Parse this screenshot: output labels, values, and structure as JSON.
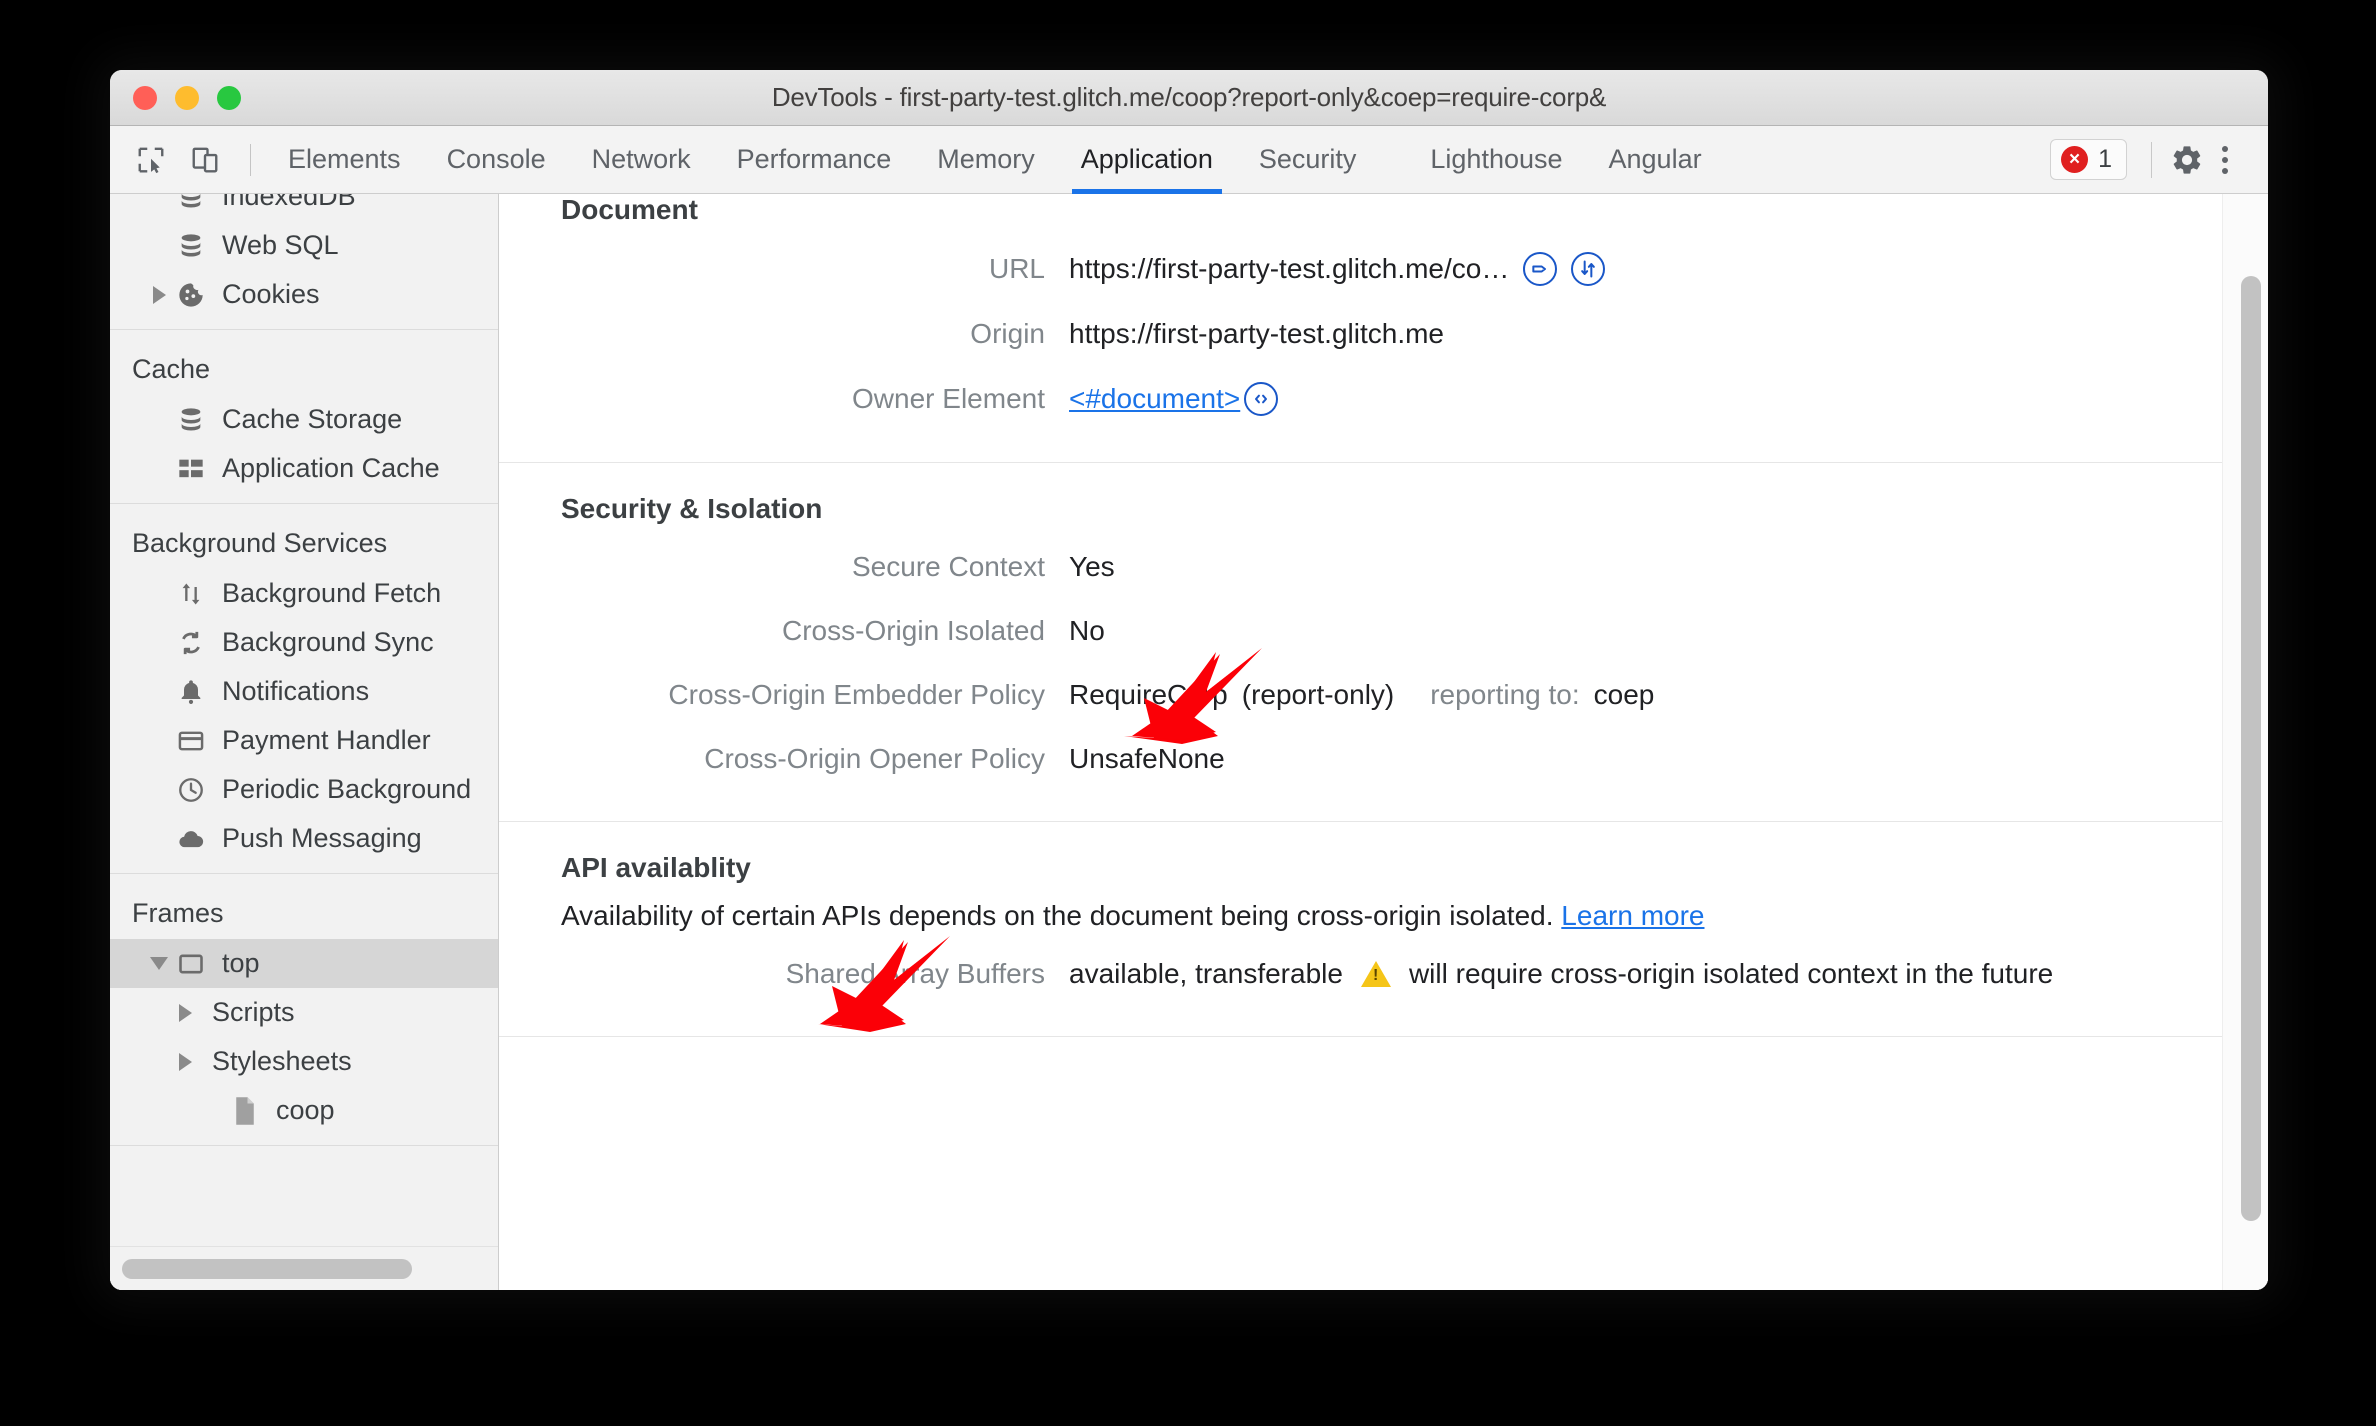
{
  "window": {
    "title": "DevTools - first-party-test.glitch.me/coop?report-only&coep=require-corp&",
    "traffic_lights": [
      "close",
      "minimize",
      "maximize"
    ]
  },
  "toolbar": {
    "inspect_icon": "inspect-element-icon",
    "device_icon": "device-toolbar-icon",
    "tabs": [
      {
        "label": "Elements",
        "active": false
      },
      {
        "label": "Console",
        "active": false
      },
      {
        "label": "Network",
        "active": false
      },
      {
        "label": "Performance",
        "active": false
      },
      {
        "label": "Memory",
        "active": false
      },
      {
        "label": "Application",
        "active": true
      },
      {
        "label": "Security",
        "active": false
      },
      {
        "label": "Lighthouse",
        "active": false
      },
      {
        "label": "Angular",
        "active": false
      }
    ],
    "error_count": "1",
    "error_icon": "error-badge-icon",
    "settings_icon": "gear-icon",
    "more_icon": "kebab-menu-icon",
    "active_tab_underline_color": "#1a73e8"
  },
  "sidebar": {
    "groups": [
      {
        "header": "",
        "items": [
          {
            "label": "IndexedDB",
            "icon": "database-icon",
            "indent": 1,
            "twisty": "none",
            "clipped": true
          },
          {
            "label": "Web SQL",
            "icon": "database-icon",
            "indent": 1,
            "twisty": "none"
          },
          {
            "label": "Cookies",
            "icon": "cookie-icon",
            "indent": 1,
            "twisty": "right"
          }
        ]
      },
      {
        "header": "Cache",
        "items": [
          {
            "label": "Cache Storage",
            "icon": "database-icon",
            "indent": 1,
            "twisty": "none"
          },
          {
            "label": "Application Cache",
            "icon": "table-icon",
            "indent": 1,
            "twisty": "none"
          }
        ]
      },
      {
        "header": "Background Services",
        "items": [
          {
            "label": "Background Fetch",
            "icon": "arrows-updown-icon",
            "indent": 1,
            "twisty": "none"
          },
          {
            "label": "Background Sync",
            "icon": "sync-icon",
            "indent": 1,
            "twisty": "none"
          },
          {
            "label": "Notifications",
            "icon": "bell-icon",
            "indent": 1,
            "twisty": "none"
          },
          {
            "label": "Payment Handler",
            "icon": "credit-card-icon",
            "indent": 1,
            "twisty": "none"
          },
          {
            "label": "Periodic Background",
            "icon": "clock-icon",
            "indent": 1,
            "twisty": "none"
          },
          {
            "label": "Push Messaging",
            "icon": "cloud-icon",
            "indent": 1,
            "twisty": "none"
          }
        ]
      },
      {
        "header": "Frames",
        "items": [
          {
            "label": "top",
            "icon": "frame-icon",
            "indent": 1,
            "twisty": "down",
            "selected": true
          },
          {
            "label": "Scripts",
            "icon": "none",
            "indent": 2,
            "twisty": "right"
          },
          {
            "label": "Stylesheets",
            "icon": "none",
            "indent": 2,
            "twisty": "right"
          },
          {
            "label": "coop",
            "icon": "document-icon",
            "indent": 3,
            "twisty": "none"
          }
        ]
      }
    ],
    "horizontal_scrollbar": "sidebar-hscrollbar"
  },
  "main": {
    "sections": [
      {
        "title": "Document",
        "clipped_title": true,
        "rows": [
          {
            "label": "URL",
            "value": "https://first-party-test.glitch.me/co…",
            "icons": [
              "tag-circle-icon",
              "network-transfer-circle-icon"
            ]
          },
          {
            "label": "Origin",
            "value": "https://first-party-test.glitch.me",
            "icons": []
          },
          {
            "label": "Owner Element",
            "value": "<#document>",
            "link": true,
            "icons": [
              "code-circle-icon"
            ]
          }
        ]
      },
      {
        "title": "Security & Isolation",
        "rows": [
          {
            "label": "Secure Context",
            "value": "Yes",
            "icons": []
          },
          {
            "label": "Cross-Origin Isolated",
            "value": "No",
            "icons": []
          },
          {
            "label": "Cross-Origin Embedder Policy",
            "value": "RequireCorp",
            "suffix": "(report-only)",
            "extra_label": "reporting to:",
            "extra_value": "coep",
            "icons": []
          },
          {
            "label": "Cross-Origin Opener Policy",
            "value": "UnsafeNone",
            "icons": []
          }
        ]
      },
      {
        "title": "API availablity",
        "note_text": "Availability of certain APIs depends on the document being cross-origin isolated.",
        "note_link": "Learn more",
        "rows": [
          {
            "label": "Shared Array Buffers",
            "value": "available, transferable",
            "warning_icon": "warning-triangle-icon",
            "warning_text": "will require cross-origin isolated context in the future",
            "icons": []
          }
        ]
      }
    ],
    "vertical_scrollbar": "main-vscrollbar"
  },
  "annotations": [
    {
      "name": "arrow-cross-origin-isolated",
      "color": "#fb0007",
      "points_to": "No"
    },
    {
      "name": "arrow-api-availablity",
      "color": "#fb0007",
      "points_to": "API availablity"
    }
  ]
}
